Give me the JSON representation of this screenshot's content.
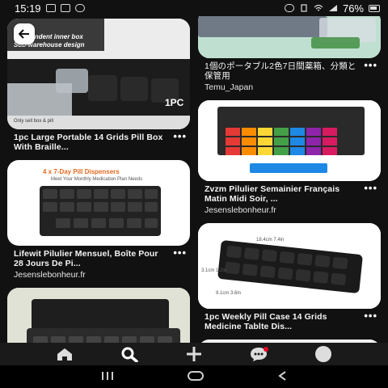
{
  "status": {
    "time": "15:19",
    "battery": "76%"
  },
  "cards_left": [
    {
      "title": "1pc Large Portable 14 Grids Pill Box With Braille...",
      "source": "",
      "image_text": {
        "headline": "Independent inner box",
        "sub": "Sub-warehouse design",
        "badge": "1PC",
        "footer": "Only sell box & pill"
      }
    },
    {
      "title": "Lifewit Pilulier Mensuel, Boîte Pour 28 Jours De Pi...",
      "source": "Jesenslebonheur.fr",
      "image_text": {
        "headline": "4 x 7-Day Pill Dispensers",
        "sub": "Meet Your Monthly Medication Plan Needs"
      }
    },
    {
      "title": "",
      "source": ""
    }
  ],
  "cards_right": [
    {
      "title": "1個のポータブル2色7日間薬箱、分類と保管用",
      "source": "Temu_Japan"
    },
    {
      "title": "Zvzm Pilulier Semainier Français Matin Midi Soir, ...",
      "source": "Jesenslebonheur.fr"
    },
    {
      "title": "1pc Weekly Pill Case 14 Grids Medicine Tablte Dis...",
      "source": "",
      "image_text": {
        "dim1": "18.4cm 7.4in",
        "dim2": "3.1cm 1.2in",
        "dim3": "9.1cm 3.6in"
      }
    },
    {
      "title": "",
      "source": ""
    }
  ],
  "more_label": "•••",
  "colors": {
    "bg": "#111111",
    "card_white": "#ffffff",
    "navbar": "#1a1a1a"
  }
}
